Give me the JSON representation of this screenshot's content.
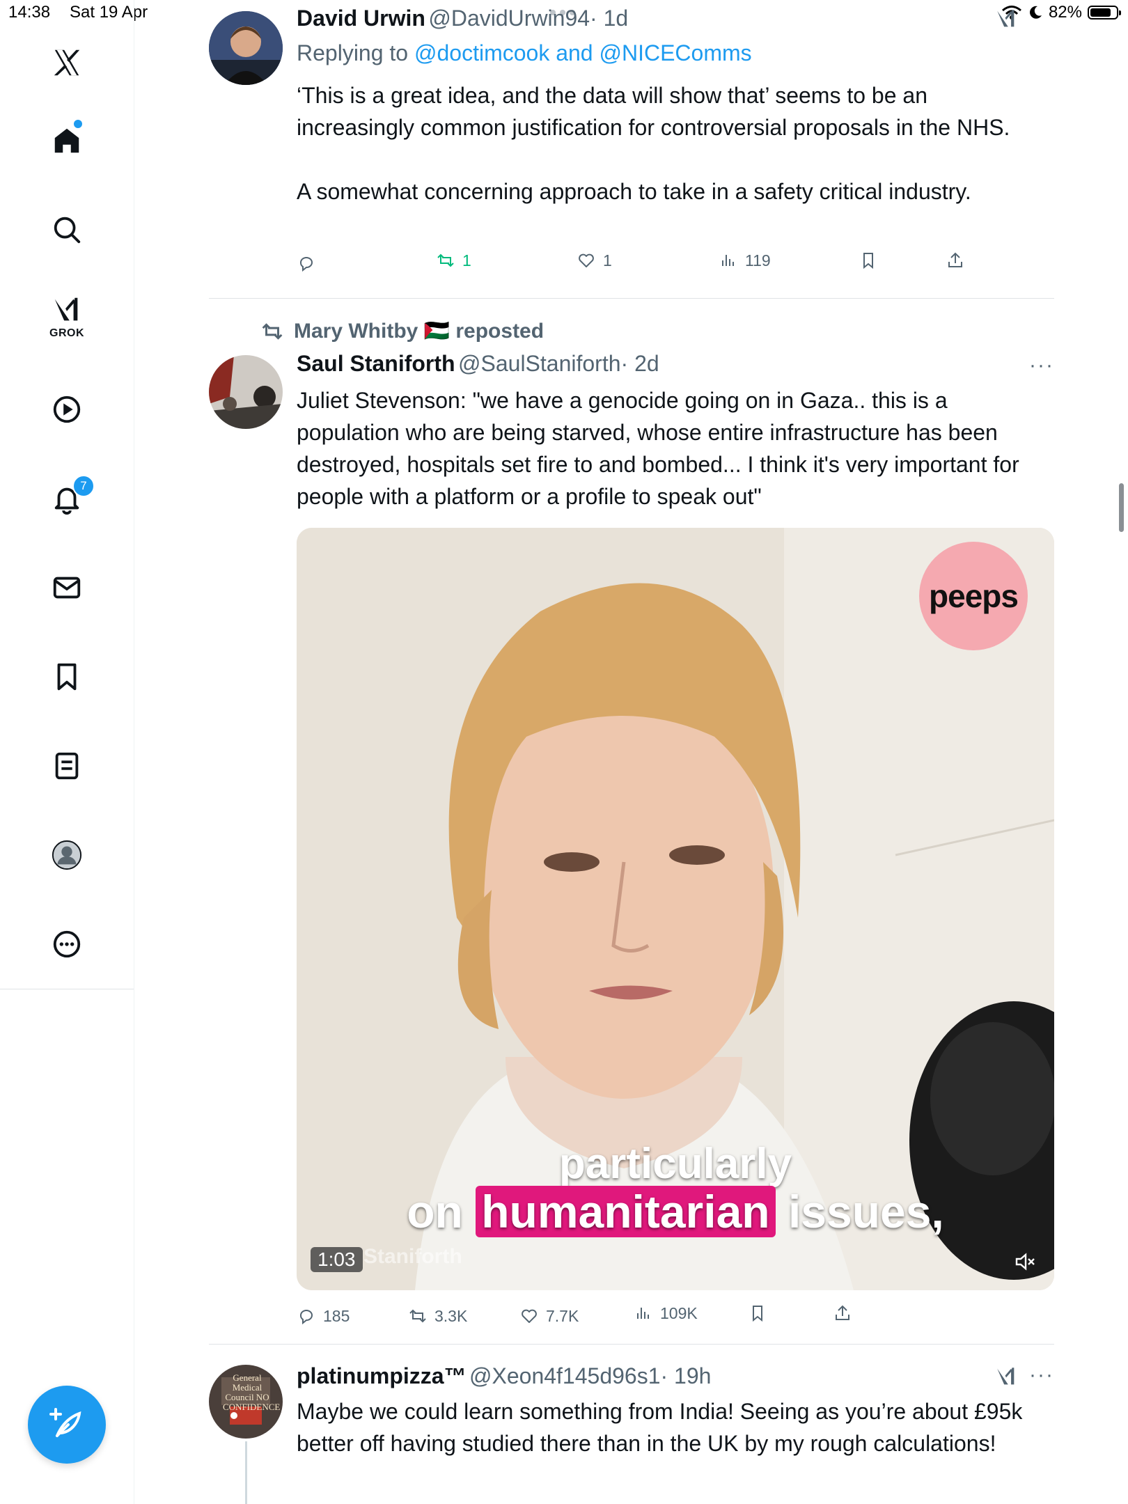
{
  "status_bar": {
    "time": "14:38",
    "date": "Sat 19 Apr",
    "battery": "82%",
    "battery_level": 0.82
  },
  "sidebar": {
    "items": [
      {
        "name": "x-logo",
        "label": ""
      },
      {
        "name": "home",
        "label": ""
      },
      {
        "name": "explore",
        "label": ""
      },
      {
        "name": "grok",
        "label": "GROK"
      },
      {
        "name": "video",
        "label": ""
      },
      {
        "name": "notifications",
        "label": "",
        "badge": "7"
      },
      {
        "name": "messages",
        "label": ""
      },
      {
        "name": "bookmarks",
        "label": ""
      },
      {
        "name": "lists",
        "label": ""
      },
      {
        "name": "profile",
        "label": ""
      },
      {
        "name": "more",
        "label": ""
      }
    ],
    "compose_label": "Post"
  },
  "tweets": [
    {
      "display_name": "David Urwin",
      "handle": "@DavidUrwin94",
      "time": "· 1d",
      "replying_prefix": "Replying to",
      "replying_users": "@doctimcook and @NICEComms",
      "text_p1": "‘This is a great idea, and the data will show that’ seems to be an increasingly common justification for controversial proposals in the NHS.",
      "text_p2": "A somewhat concerning approach to take in a safety critical industry.",
      "replies": "",
      "reposts": "1",
      "likes": "1",
      "views": "119"
    },
    {
      "reposted_by": "Mary Whitby 🇵🇸 reposted",
      "display_name": "Saul Staniforth",
      "handle": "@SaulStaniforth",
      "time": "· 2d",
      "text": "Juliet Stevenson: \"we have a genocide going on in Gaza.. this is a population who are being starved, whose entire infrastructure has been destroyed, hospitals set fire to and bombed... I think it's very important for people with a platform or a profile to speak out\"",
      "video": {
        "logo": "peeps",
        "caption_line1": "particularly",
        "caption_on": "on",
        "caption_highlight": "humanitarian",
        "caption_rest": "issues,",
        "duration": "1:03",
        "watermark": "Staniforth"
      },
      "replies": "185",
      "reposts": "3.3K",
      "likes": "7.7K",
      "views": "109K"
    },
    {
      "display_name": "platinumpizza™",
      "handle": "@Xeon4f145d96s1",
      "time": "· 19h",
      "text": "Maybe we could learn something from India! Seeing as you’re about £95k better off having studied there than in the UK by my rough calculations!",
      "avatar_text": "General Medical Council NO CONFIDENCE"
    }
  ]
}
